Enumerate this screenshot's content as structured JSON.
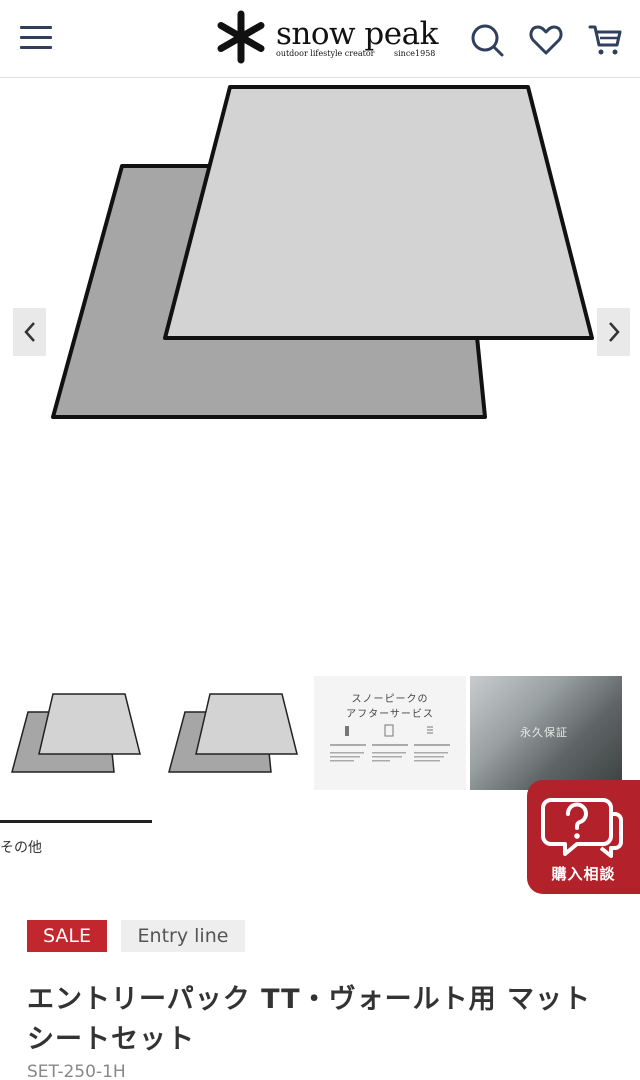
{
  "header": {
    "menu_icon": "hamburger-menu-icon",
    "logo": {
      "brand": "snow peak",
      "tagline": "outdoor lifestyle creator",
      "since": "since1958"
    },
    "icons": [
      "search-icon",
      "heart-icon",
      "cart-icon"
    ],
    "brand_color": "#2f3f5c"
  },
  "gallery": {
    "prev_icon": "chevron-left-icon",
    "next_icon": "chevron-right-icon",
    "thumbnails": [
      {
        "kind": "product-mats"
      },
      {
        "kind": "product-mats"
      },
      {
        "kind": "service",
        "title_line1": "スノーピークの",
        "title_line2": "アフターサービス"
      },
      {
        "kind": "photo",
        "caption": "永久保証"
      }
    ],
    "tab_label": "その他"
  },
  "consult_button": {
    "label": "購入相談",
    "color": "#b3222a"
  },
  "product": {
    "badges": {
      "sale": "SALE",
      "line": "Entry line"
    },
    "title": "エントリーパック TT・ヴォールト用 マットシートセット",
    "code": "SET-250-1H"
  }
}
